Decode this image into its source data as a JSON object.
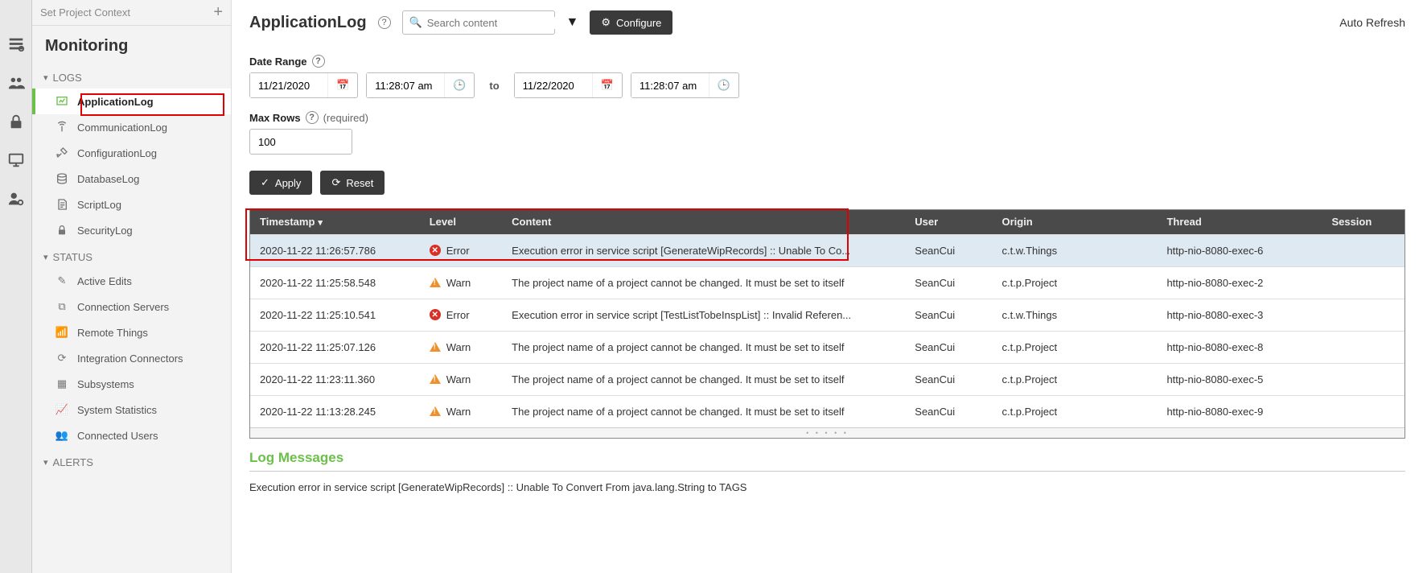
{
  "context_placeholder": "Set Project Context",
  "section_title": "Monitoring",
  "groups": {
    "logs": {
      "label": "LOGS"
    },
    "status": {
      "label": "STATUS"
    },
    "alerts": {
      "label": "ALERTS"
    }
  },
  "nav": {
    "applicationLog": "ApplicationLog",
    "communicationLog": "CommunicationLog",
    "configurationLog": "ConfigurationLog",
    "databaseLog": "DatabaseLog",
    "scriptLog": "ScriptLog",
    "securityLog": "SecurityLog",
    "activeEdits": "Active Edits",
    "connectionServers": "Connection Servers",
    "remoteThings": "Remote Things",
    "integrationConnectors": "Integration Connectors",
    "subsystems": "Subsystems",
    "systemStatistics": "System Statistics",
    "connectedUsers": "Connected Users"
  },
  "header": {
    "title": "ApplicationLog",
    "search_placeholder": "Search content",
    "configure": "Configure",
    "auto_refresh": "Auto Refresh"
  },
  "form": {
    "date_range_label": "Date Range",
    "from_date": "11/21/2020",
    "from_time": "11:28:07 am",
    "to_label": "to",
    "to_date": "11/22/2020",
    "to_time": "11:28:07 am",
    "max_rows_label": "Max Rows",
    "required": "(required)",
    "max_rows_value": "100",
    "apply": "Apply",
    "reset": "Reset"
  },
  "table": {
    "columns": {
      "timestamp": "Timestamp",
      "level": "Level",
      "content": "Content",
      "user": "User",
      "origin": "Origin",
      "thread": "Thread",
      "session": "Session"
    },
    "rows": [
      {
        "timestamp": "2020-11-22 11:26:57.786",
        "level": "Error",
        "content": "Execution error in service script [GenerateWipRecords] :: Unable To Co...",
        "user": "SeanCui",
        "origin": "c.t.w.Things",
        "thread": "http-nio-8080-exec-6"
      },
      {
        "timestamp": "2020-11-22 11:25:58.548",
        "level": "Warn",
        "content": "The project name of a project cannot be changed. It must be set to itself",
        "user": "SeanCui",
        "origin": "c.t.p.Project",
        "thread": "http-nio-8080-exec-2"
      },
      {
        "timestamp": "2020-11-22 11:25:10.541",
        "level": "Error",
        "content": "Execution error in service script [TestListTobeInspList] :: Invalid Referen...",
        "user": "SeanCui",
        "origin": "c.t.w.Things",
        "thread": "http-nio-8080-exec-3"
      },
      {
        "timestamp": "2020-11-22 11:25:07.126",
        "level": "Warn",
        "content": "The project name of a project cannot be changed. It must be set to itself",
        "user": "SeanCui",
        "origin": "c.t.p.Project",
        "thread": "http-nio-8080-exec-8"
      },
      {
        "timestamp": "2020-11-22 11:23:11.360",
        "level": "Warn",
        "content": "The project name of a project cannot be changed. It must be set to itself",
        "user": "SeanCui",
        "origin": "c.t.p.Project",
        "thread": "http-nio-8080-exec-5"
      },
      {
        "timestamp": "2020-11-22 11:13:28.245",
        "level": "Warn",
        "content": "The project name of a project cannot be changed. It must be set to itself",
        "user": "SeanCui",
        "origin": "c.t.p.Project",
        "thread": "http-nio-8080-exec-9"
      }
    ]
  },
  "log_messages": {
    "title": "Log Messages",
    "body": "Execution error in service script [GenerateWipRecords] :: Unable To Convert From java.lang.String to TAGS"
  }
}
